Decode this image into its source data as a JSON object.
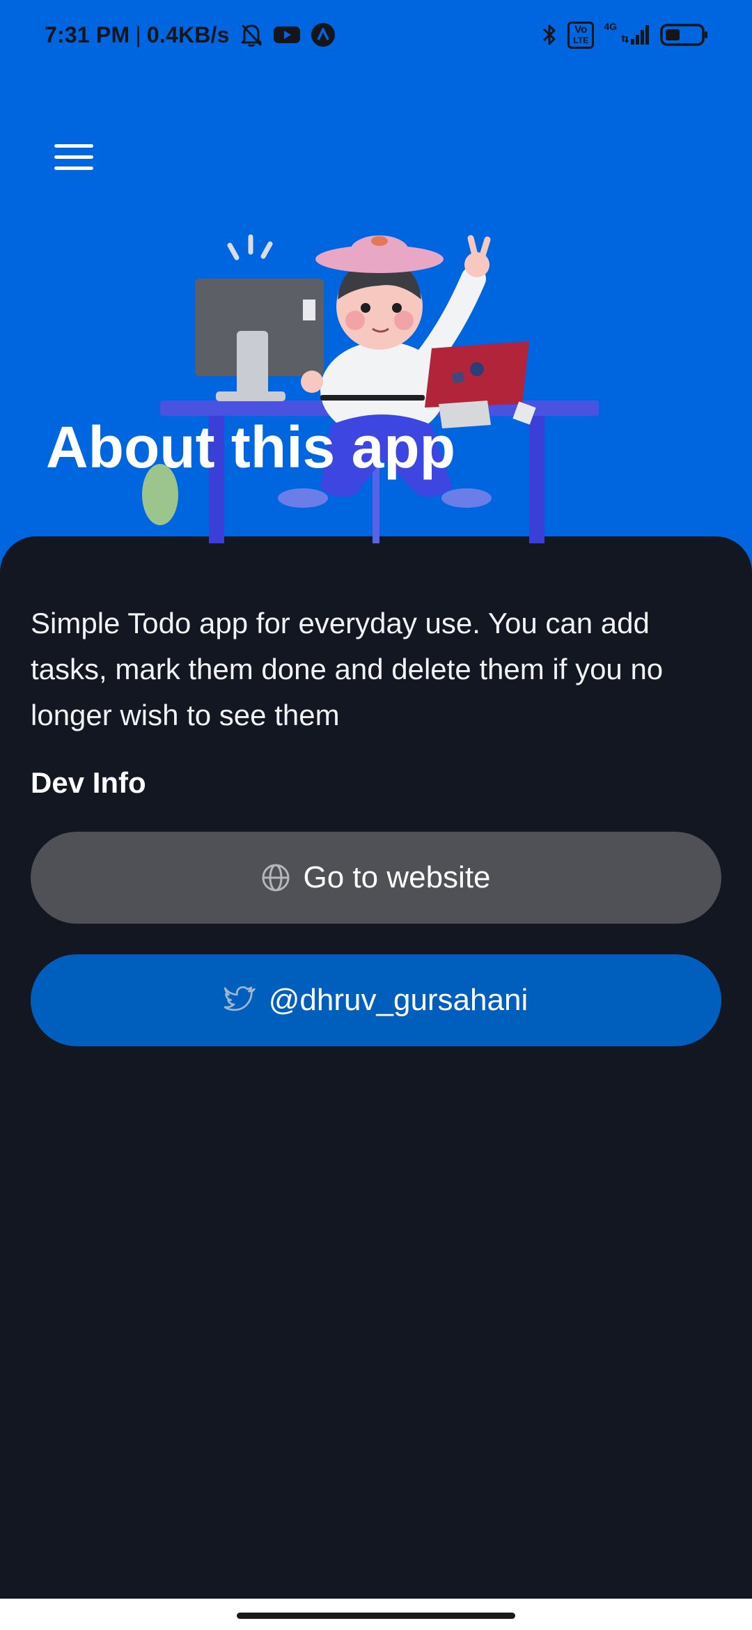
{
  "status_bar": {
    "time": "7:31 PM",
    "separator": "|",
    "speed": "0.4KB/s",
    "volte_top": "Vo",
    "volte_bottom": "LTE",
    "network": "4G"
  },
  "header": {
    "title": "About this app"
  },
  "content": {
    "description": "Simple Todo app for everyday use. You can add tasks, mark them done and delete them if you no longer wish to see them",
    "dev_info_heading": "Dev Info",
    "website_button_label": "Go to website",
    "twitter_button_label": "@dhruv_gursahani"
  },
  "colors": {
    "header_background": "#0066e0",
    "sheet_background": "#121721",
    "website_button": "#505157",
    "twitter_button": "#005fbd"
  },
  "icons": {
    "menu": "hamburger-menu-icon",
    "website": "globe-icon",
    "twitter": "twitter-bird-icon"
  }
}
